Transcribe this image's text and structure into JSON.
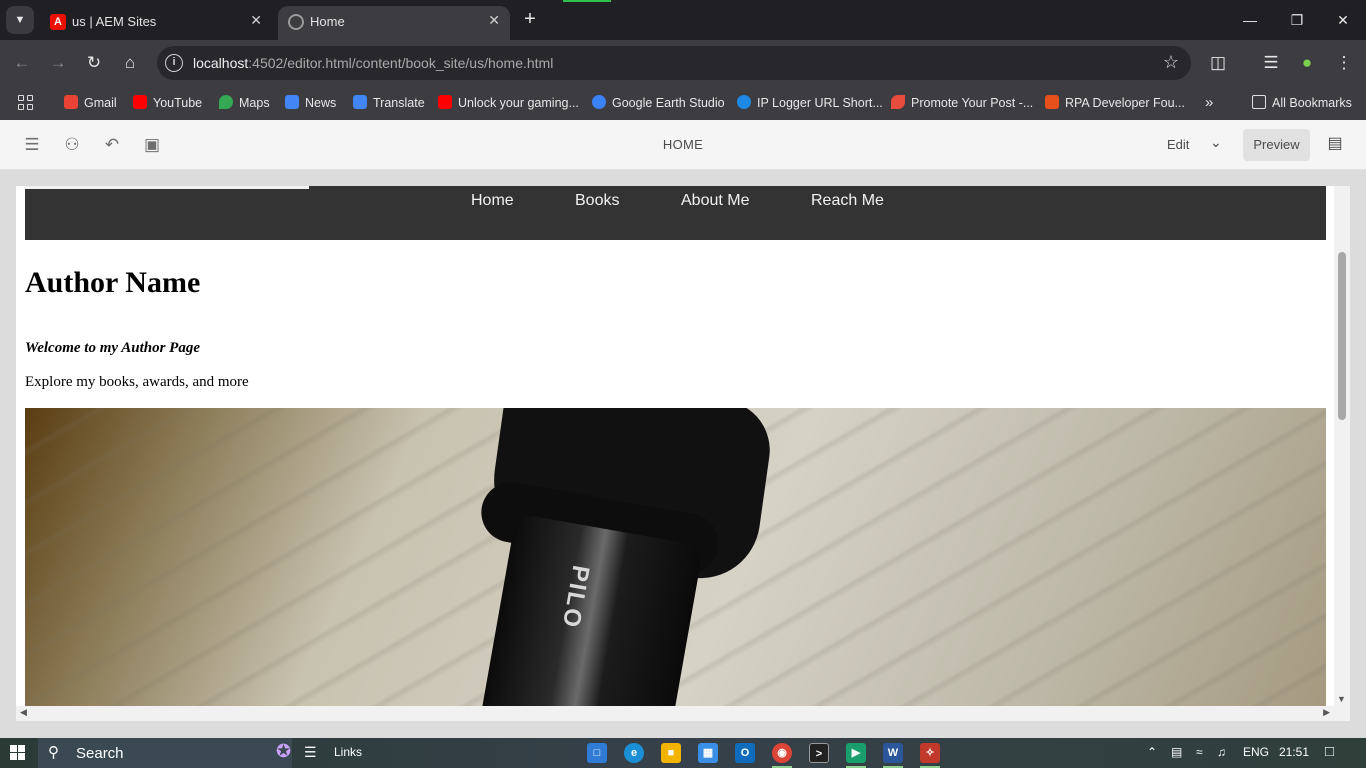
{
  "browser": {
    "tabs": [
      {
        "title": "us | AEM Sites",
        "active": false
      },
      {
        "title": "Home",
        "active": true
      }
    ],
    "new_tab": "+",
    "url_host": "localhost",
    "url_rest": ":4502/editor.html/content/book_site/us/home.html",
    "bookmarks": [
      {
        "label": "Gmail",
        "color": "#ea4335"
      },
      {
        "label": "YouTube",
        "color": "#ff0000"
      },
      {
        "label": "Maps",
        "color": "#34a853"
      },
      {
        "label": "News",
        "color": "#4285f4"
      },
      {
        "label": "Translate",
        "color": "#4285f4"
      },
      {
        "label": "Unlock your gaming...",
        "color": "#ff0000"
      },
      {
        "label": "Google Earth Studio",
        "color": "#3b82f6"
      },
      {
        "label": "IP Logger URL Short...",
        "color": "#1e88e5"
      },
      {
        "label": "Promote Your Post -...",
        "color": "#e74c3c"
      },
      {
        "label": "RPA Developer Fou...",
        "color": "#e8501a"
      }
    ],
    "more_bookmarks": "»",
    "all_bookmarks": "All Bookmarks"
  },
  "editor": {
    "page_title": "HOME",
    "mode_label": "Edit",
    "preview_label": "Preview"
  },
  "site": {
    "nav_links": [
      "Home",
      "Books",
      "About Me",
      "Reach Me"
    ],
    "author_name": "Author Name",
    "welcome": "Welcome to my Author Page",
    "tagline": "Explore my books, awards, and more",
    "hero_pen_text": "PILO"
  },
  "taskbar": {
    "search_label": "Search",
    "links_label": "Links",
    "language": "ENG",
    "time": "21:51"
  },
  "colors": {
    "accent_green": "#2fbf4a",
    "site_nav_bg": "#333333",
    "aem_red": "#eb1000"
  }
}
